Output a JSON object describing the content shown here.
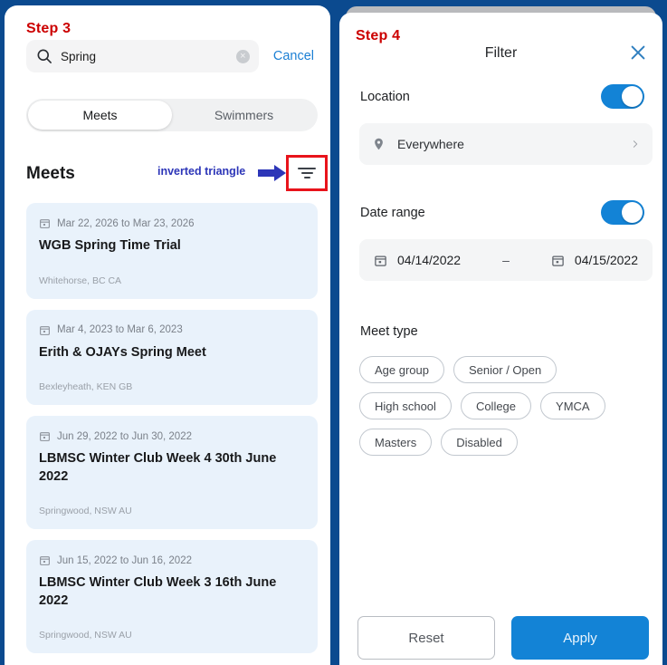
{
  "annotations": {
    "step3": "Step 3",
    "step4": "Step 4",
    "inverted_triangle_note": "inverted triangle",
    "highlight_color": "#e8131b",
    "arrow_color": "#2d36b8",
    "step_label_color": "#cc0000"
  },
  "theme": {
    "accent_blue": "#1383d6",
    "link_blue": "#1b7fd4",
    "card_blue": "#e9f2fb",
    "field_gray": "#f4f5f6",
    "window_blue": "#0b4a8f"
  },
  "left_panel": {
    "search": {
      "value": "Spring",
      "placeholder": "Search",
      "clear_glyph": "×",
      "cancel_label": "Cancel",
      "search_icon": "search-icon"
    },
    "tabs": [
      {
        "label": "Meets",
        "active": true
      },
      {
        "label": "Swimmers",
        "active": false
      }
    ],
    "section_title": "Meets",
    "filter_icon": "filter-icon",
    "meets": [
      {
        "date": "Mar 22, 2026 to Mar 23, 2026",
        "title": "WGB Spring Time Trial",
        "location": "Whitehorse, BC CA"
      },
      {
        "date": "Mar 4, 2023 to Mar 6, 2023",
        "title": "Erith & OJAYs Spring Meet",
        "location": "Bexleyheath, KEN GB"
      },
      {
        "date": "Jun 29, 2022 to Jun 30, 2022",
        "title": "LBMSC Winter Club Week 4 30th June 2022",
        "location": "Springwood, NSW AU"
      },
      {
        "date": "Jun 15, 2022 to Jun 16, 2022",
        "title": "LBMSC Winter Club Week 3 16th June 2022",
        "location": "Springwood, NSW AU"
      }
    ]
  },
  "right_panel": {
    "title": "Filter",
    "close_icon": "close-icon",
    "location": {
      "label": "Location",
      "enabled": true,
      "value": "Everywhere",
      "pin_icon": "map-pin-icon",
      "chevron_icon": "chevron-right-icon"
    },
    "date_range": {
      "label": "Date range",
      "enabled": true,
      "start": "04/14/2022",
      "end": "04/15/2022",
      "separator": "–",
      "calendar_icon": "calendar-icon"
    },
    "meet_type": {
      "label": "Meet type",
      "options": [
        {
          "label": "Age group",
          "selected": false
        },
        {
          "label": "Senior / Open",
          "selected": false
        },
        {
          "label": "High school",
          "selected": false
        },
        {
          "label": "College",
          "selected": false
        },
        {
          "label": "YMCA",
          "selected": false
        },
        {
          "label": "Masters",
          "selected": false
        },
        {
          "label": "Disabled",
          "selected": false
        }
      ]
    },
    "reset_label": "Reset",
    "apply_label": "Apply"
  }
}
